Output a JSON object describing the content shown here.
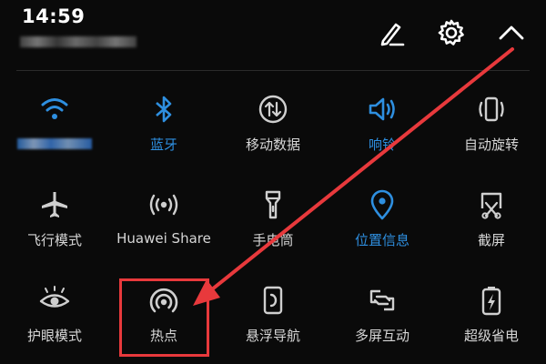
{
  "status": {
    "time": "14:59"
  },
  "header": {
    "edit_icon": "edit-icon",
    "settings_icon": "gear-icon",
    "collapse_icon": "chevron-up-icon"
  },
  "tiles": [
    {
      "label": "",
      "icon": "wifi-icon",
      "active": true
    },
    {
      "label": "蓝牙",
      "icon": "bluetooth-icon",
      "active": true
    },
    {
      "label": "移动数据",
      "icon": "mobile-data-icon",
      "active": false
    },
    {
      "label": "响铃",
      "icon": "ring-icon",
      "active": true
    },
    {
      "label": "自动旋转",
      "icon": "auto-rotate-icon",
      "active": false
    },
    {
      "label": "飞行模式",
      "icon": "airplane-icon",
      "active": false
    },
    {
      "label": "Huawei Share",
      "icon": "huawei-share-icon",
      "active": false
    },
    {
      "label": "手电筒",
      "icon": "flashlight-icon",
      "active": false
    },
    {
      "label": "位置信息",
      "icon": "location-icon",
      "active": true
    },
    {
      "label": "截屏",
      "icon": "screenshot-icon",
      "active": false
    },
    {
      "label": "护眼模式",
      "icon": "eye-comfort-icon",
      "active": false
    },
    {
      "label": "热点",
      "icon": "hotspot-icon",
      "active": false
    },
    {
      "label": "悬浮导航",
      "icon": "floating-nav-icon",
      "active": false
    },
    {
      "label": "多屏互动",
      "icon": "multi-screen-icon",
      "active": false
    },
    {
      "label": "超级省电",
      "icon": "ultra-power-saving-icon",
      "active": false
    }
  ],
  "colors": {
    "background": "#0a0a0a",
    "active": "#2e8fe0",
    "inactive": "#d6d6d6",
    "annotation": "#e8393c"
  }
}
